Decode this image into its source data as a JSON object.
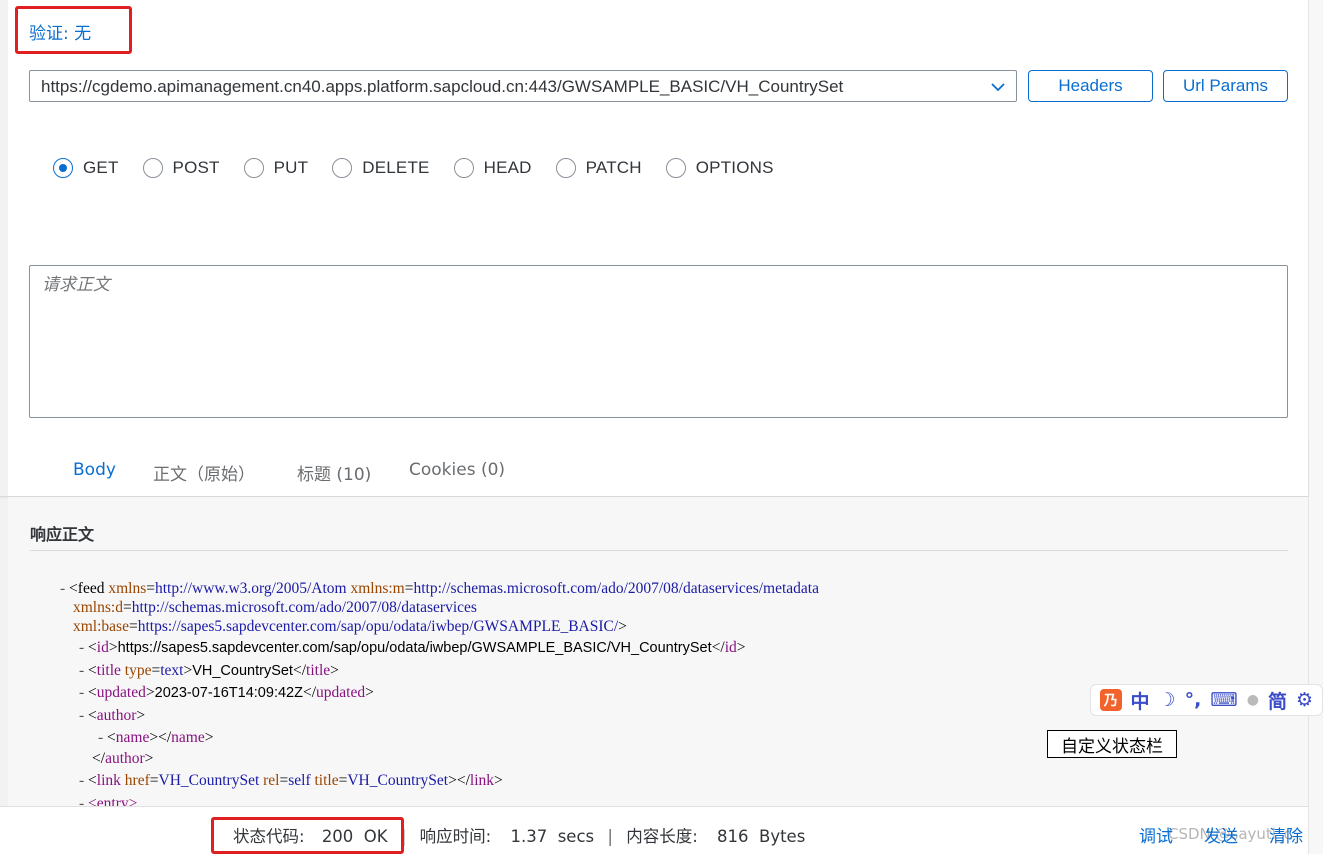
{
  "auth": {
    "label": "验证: 无"
  },
  "url": {
    "value": "https://cgdemo.apimanagement.cn40.apps.platform.sapcloud.cn:443/GWSAMPLE_BASIC/VH_CountrySet"
  },
  "buttons": {
    "headers": "Headers",
    "url_params": "Url Params"
  },
  "methods": {
    "selected": "GET",
    "options": [
      "GET",
      "POST",
      "PUT",
      "DELETE",
      "HEAD",
      "PATCH",
      "OPTIONS"
    ]
  },
  "request_body": {
    "placeholder": "请求正文"
  },
  "tabs": {
    "body": "Body",
    "raw": "正文（原始）",
    "headers": "标题 (10)",
    "cookies": "Cookies (0)"
  },
  "response": {
    "title": "响应正文",
    "xml": {
      "dash": "-",
      "feed_open": "<feed",
      "xmlns_attr": "xmlns",
      "xmlns_val": "http://www.w3.org/2005/Atom",
      "xmlns_m_attr": "xmlns:m",
      "xmlns_m_val": "http://schemas.microsoft.com/ado/2007/08/dataservices/metadata",
      "xmlns_d_attr": "xmlns:d",
      "xmlns_d_val": "http://schemas.microsoft.com/ado/2007/08/dataservices",
      "xml_base_attr": "xml:base",
      "xml_base_val": "https://sapes5.sapdevcenter.com/sap/opu/odata/iwbep/GWSAMPLE_BASIC/",
      "id_open": "id",
      "id_text": "https://sapes5.sapdevcenter.com/sap/opu/odata/iwbep/GWSAMPLE_BASIC/VH_CountrySet",
      "title_tag": "title",
      "title_type_attr": "type",
      "title_type_val": "text",
      "title_text": "VH_CountrySet",
      "updated_tag": "updated",
      "updated_text": "2023-07-16T14:09:42Z",
      "author_tag": "author",
      "name_tag": "name",
      "link_tag": "link",
      "href_attr": "href",
      "href_val": "VH_CountrySet",
      "rel_attr": "rel",
      "rel_val": "self",
      "link_title_attr": "title",
      "link_title_val": "VH_CountrySet",
      "entry_tag": "<entry>"
    }
  },
  "ime_toolbar": {
    "logo": "乃",
    "mode": "中",
    "moon": "☽",
    "punct": "°,",
    "keyboard": "⌨",
    "user": "●",
    "simplified": "简",
    "settings": "⚙"
  },
  "custom_status_bar": "自定义状态栏",
  "footer": {
    "status_label": "状态代码:",
    "status_value": "200  OK",
    "time_label": "响应时间:",
    "time_value": "1.37  secs",
    "length_label": "内容长度:",
    "length_value": "816  Bytes",
    "debug": "调试",
    "send": "发送",
    "clear": "清除",
    "watermark": "CSDN @sayuti_c"
  },
  "colors": {
    "accent": "#0a6ed1",
    "highlight_box": "#e02020",
    "xml_tag": "#881280",
    "xml_attr": "#994500",
    "xml_value": "#1a1aa6"
  }
}
